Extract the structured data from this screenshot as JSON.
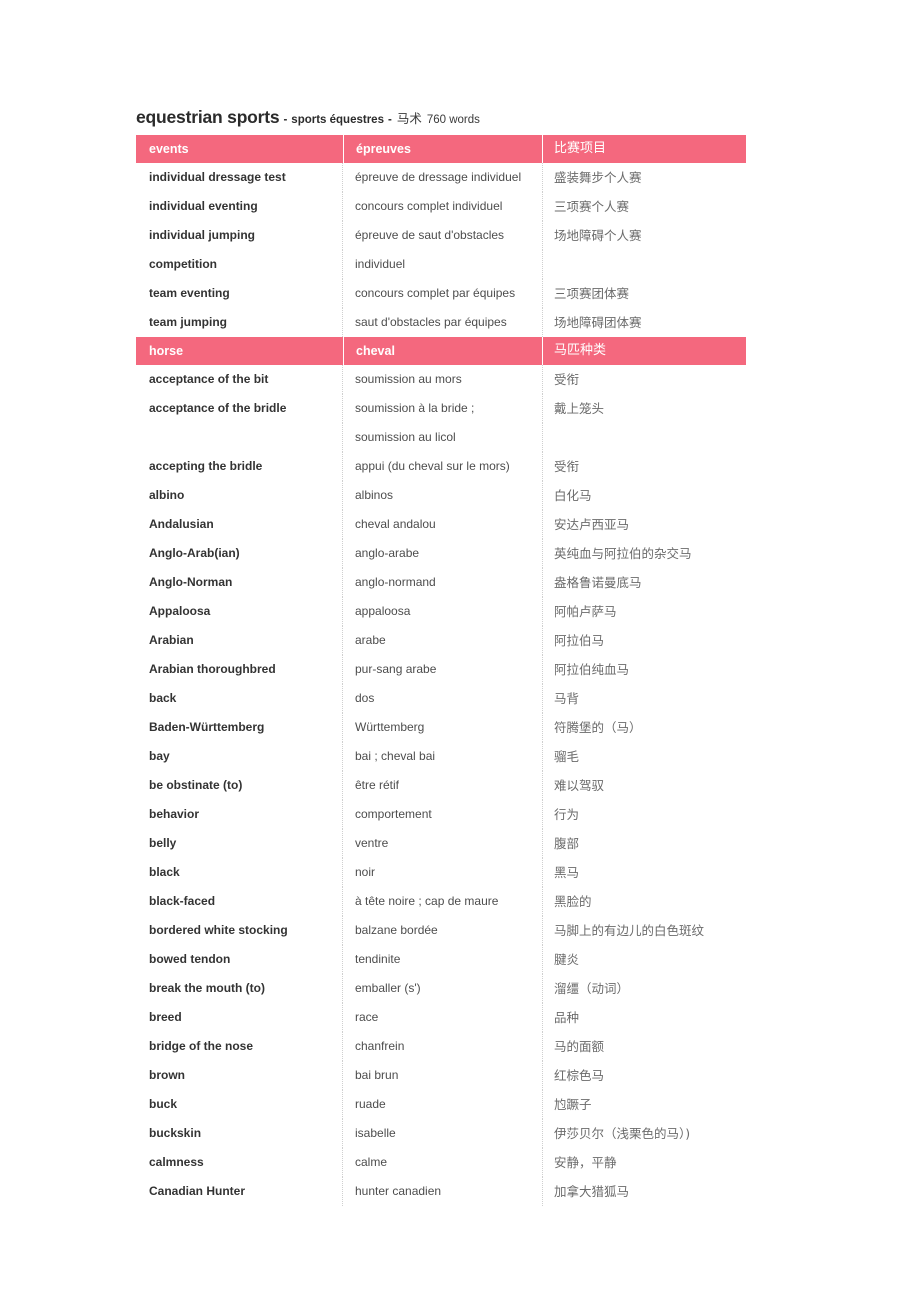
{
  "title": {
    "term_en": "equestrian sports",
    "separator_left": "-",
    "term_fr": "sports équestres",
    "separator_right": "-",
    "term_zh": "马术",
    "word_count": "760 words"
  },
  "colors": {
    "header_bar": "#f4687e",
    "header_text": "#ffffff",
    "en_text": "#333333",
    "fr_text": "#4d4d4d",
    "zh_text": "#6b6b6b",
    "divider": "#cfcfcf"
  },
  "sections": [
    {
      "header": {
        "en": "events",
        "fr": "épreuves",
        "zh": "比赛项目"
      },
      "rows": [
        {
          "en": "individual dressage test",
          "fr": "épreuve de dressage individuel",
          "zh": "盛装舞步个人赛"
        },
        {
          "en": "individual eventing",
          "fr": "concours complet individuel",
          "zh": "三项赛个人赛"
        },
        {
          "en": "individual jumping",
          "fr": "épreuve de saut d'obstacles",
          "zh": "场地障碍个人赛"
        },
        {
          "en": "competition",
          "fr": "individuel",
          "zh": ""
        },
        {
          "en": "team eventing",
          "fr": "concours complet par équipes",
          "zh": "三项赛团体赛"
        },
        {
          "en": "team jumping",
          "fr": "saut d'obstacles par équipes",
          "zh": "场地障碍团体赛"
        }
      ]
    },
    {
      "header": {
        "en": "horse",
        "fr": "cheval",
        "zh": "马匹种类"
      },
      "rows": [
        {
          "en": "acceptance of the bit",
          "fr": "soumission au mors",
          "zh": "受衔"
        },
        {
          "en": "acceptance of the bridle",
          "fr": "soumission à la bride ;",
          "zh": "戴上笼头"
        },
        {
          "en": "",
          "fr": "soumission au licol",
          "zh": ""
        },
        {
          "en": "accepting the bridle",
          "fr": "appui (du cheval sur le mors)",
          "zh": "受衔"
        },
        {
          "en": "albino",
          "fr": "albinos",
          "zh": "白化马"
        },
        {
          "en": "Andalusian",
          "fr": "cheval andalou",
          "zh": "安达卢西亚马"
        },
        {
          "en": "Anglo-Arab(ian)",
          "fr": "anglo-arabe",
          "zh": "英纯血与阿拉伯的杂交马"
        },
        {
          "en": "Anglo-Norman",
          "fr": "anglo-normand",
          "zh": "盎格鲁诺曼底马"
        },
        {
          "en": "Appaloosa",
          "fr": "appaloosa",
          "zh": "阿帕卢萨马"
        },
        {
          "en": "Arabian",
          "fr": "arabe",
          "zh": "阿拉伯马"
        },
        {
          "en": "Arabian thoroughbred",
          "fr": "pur-sang arabe",
          "zh": "阿拉伯纯血马"
        },
        {
          "en": "back",
          "fr": "dos",
          "zh": "马背"
        },
        {
          "en": "Baden-Württemberg",
          "fr": "Württemberg",
          "zh": "符腾堡的（马）"
        },
        {
          "en": "bay",
          "fr": "bai ; cheval bai",
          "zh": "骝毛"
        },
        {
          "en": "be obstinate (to)",
          "fr": "être rétif",
          "zh": "难以驾驭"
        },
        {
          "en": "behavior",
          "fr": "comportement",
          "zh": "行为"
        },
        {
          "en": "belly",
          "fr": "ventre",
          "zh": "腹部"
        },
        {
          "en": "black",
          "fr": "noir",
          "zh": "黑马"
        },
        {
          "en": "black-faced",
          "fr": "à tête noire ; cap de maure",
          "zh": "黑脸的"
        },
        {
          "en": "bordered white stocking",
          "fr": "balzane bordée",
          "zh": "马脚上的有边儿的白色斑纹"
        },
        {
          "en": "bowed tendon",
          "fr": "tendinite",
          "zh": "腱炎"
        },
        {
          "en": "break the mouth (to)",
          "fr": "emballer (s')",
          "zh": "溜缰（动词）"
        },
        {
          "en": "breed",
          "fr": "race",
          "zh": "品种"
        },
        {
          "en": "bridge of the nose",
          "fr": "chanfrein",
          "zh": "马的面额"
        },
        {
          "en": "brown",
          "fr": "bai brun",
          "zh": "红棕色马"
        },
        {
          "en": "buck",
          "fr": "ruade",
          "zh": "尥蹶子"
        },
        {
          "en": "buckskin",
          "fr": "isabelle",
          "zh": "伊莎贝尔（浅栗色的马）)"
        },
        {
          "en": "calmness",
          "fr": "calme",
          "zh": "安静，平静"
        },
        {
          "en": "Canadian Hunter",
          "fr": "hunter canadien",
          "zh": "加拿大猎狐马"
        }
      ]
    }
  ]
}
